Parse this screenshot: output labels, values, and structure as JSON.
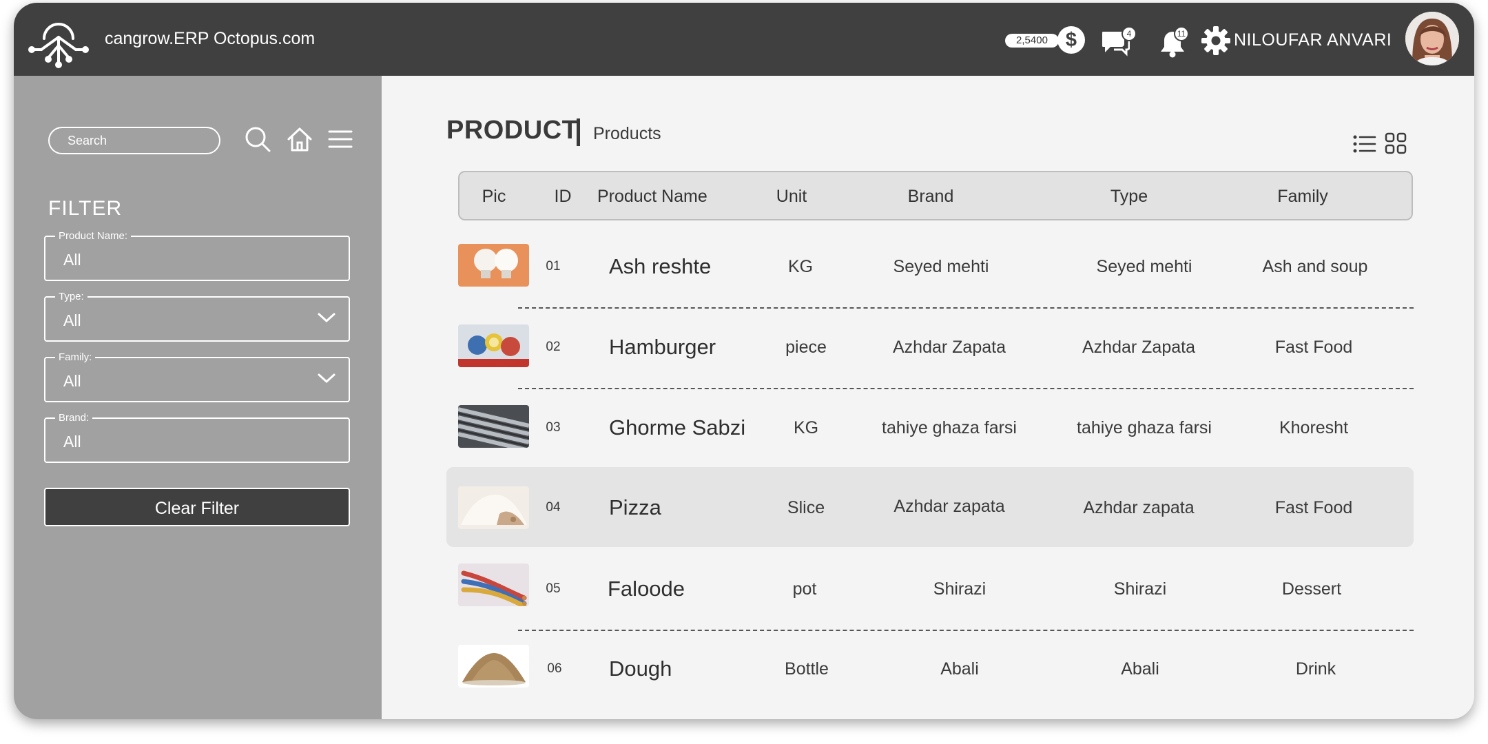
{
  "header": {
    "app_title": "cangrow.ERP Octopus.com",
    "balance": "2,5400",
    "currency_symbol": "$",
    "messages_count": "4",
    "notifications_count": "11",
    "user_name": "NILOUFAR ANVARI",
    "icons": [
      "octopus-logo-icon",
      "dollar-icon",
      "chat-icon",
      "bell-icon",
      "gear-icon"
    ]
  },
  "sidebar": {
    "search_placeholder": "Search",
    "filter_title": "FILTER",
    "fields": [
      {
        "label": "Product Name:",
        "value": "All",
        "dropdown": false
      },
      {
        "label": "Type:",
        "value": "All",
        "dropdown": true
      },
      {
        "label": "Family:",
        "value": "All",
        "dropdown": true
      },
      {
        "label": "Brand:",
        "value": "All",
        "dropdown": false
      }
    ],
    "clear_filter": "Clear Filter",
    "icons": [
      "search-icon",
      "home-icon",
      "menu-icon"
    ]
  },
  "main": {
    "title": "PRODUCT",
    "subtitle": "Products",
    "view_modes": [
      "list-view-icon",
      "grid-view-icon"
    ],
    "columns": [
      "Pic",
      "ID",
      "Product Name",
      "Unit",
      "Brand",
      "Type",
      "Family"
    ],
    "rows": [
      {
        "id": "01",
        "name": "Ash reshte",
        "unit": "KG",
        "brand": "Seyed mehti",
        "type": "Seyed mehti",
        "family": "Ash and soup",
        "pic": "light-bulbs"
      },
      {
        "id": "02",
        "name": "Hamburger",
        "unit": "piece",
        "brand": "Azhdar Zapata",
        "type": "Azhdar Zapata",
        "family": "Fast Food",
        "pic": "paint-cans"
      },
      {
        "id": "03",
        "name": "Ghorme Sabzi",
        "unit": "KG",
        "brand": "tahiye ghaza farsi",
        "type": "tahiye ghaza farsi",
        "family": "Khoresht",
        "pic": "steel-pipes"
      },
      {
        "id": "04",
        "name": "Pizza",
        "unit": "Slice",
        "brand": "Azhdar zapata",
        "type": "Azhdar zapata",
        "family": "Fast Food",
        "pic": "flour-pile"
      },
      {
        "id": "05",
        "name": "Faloode",
        "unit": "pot",
        "brand": "Shirazi",
        "type": "Shirazi",
        "family": "Dessert",
        "pic": "cables"
      },
      {
        "id": "06",
        "name": "Dough",
        "unit": "Bottle",
        "brand": "Abali",
        "type": "Abali",
        "family": "Drink",
        "pic": "sand-pile"
      }
    ]
  },
  "colors": {
    "header_bg": "#404040",
    "sidebar_bg": "#a1a1a1",
    "content_bg": "#f4f4f4",
    "table_header_bg": "#e2e2e2",
    "highlight_row_bg": "#e4e4e4"
  }
}
